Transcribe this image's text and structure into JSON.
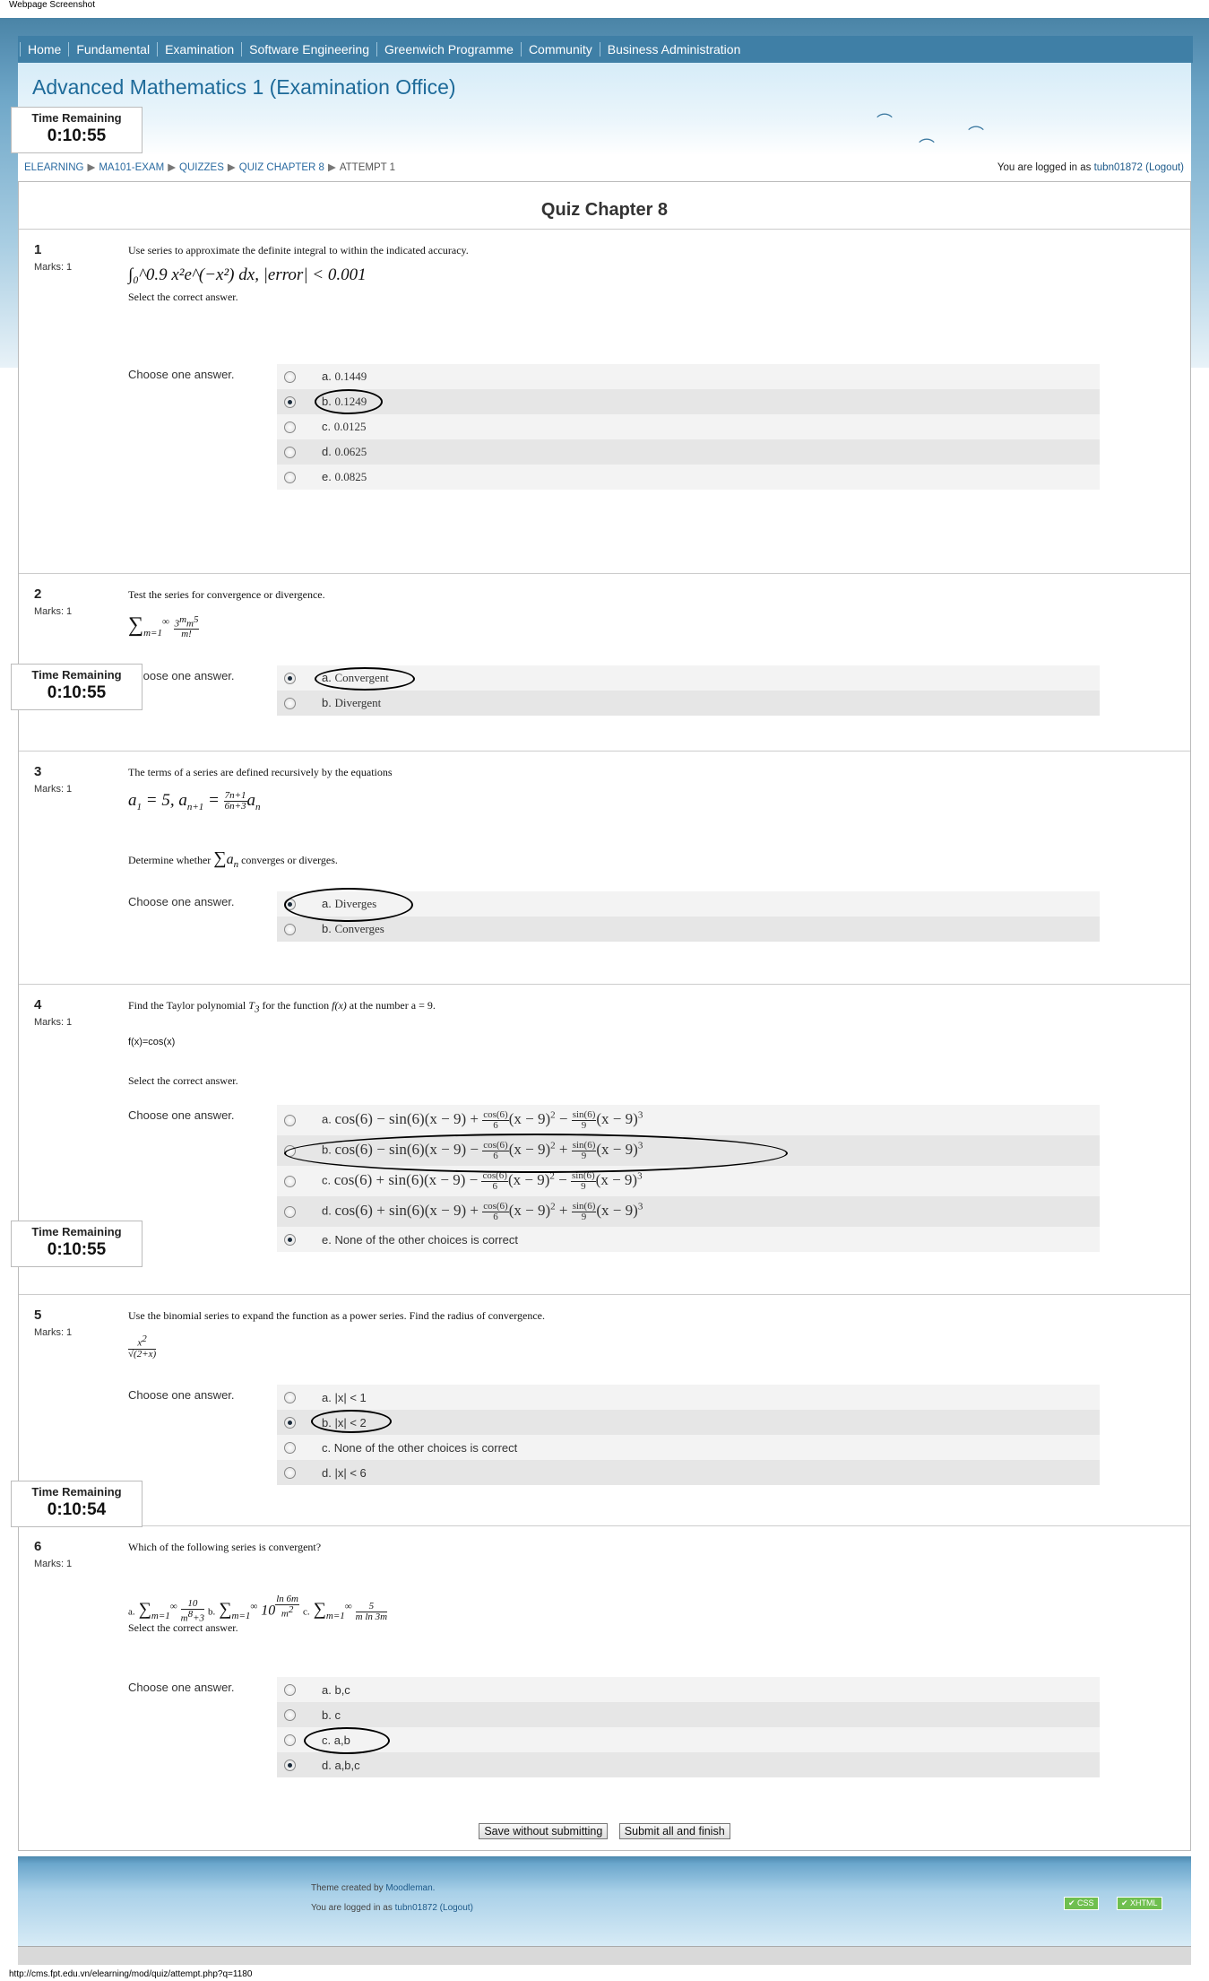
{
  "caption_top": "Webpage Screenshot",
  "caption_bottom": "http://cms.fpt.edu.vn/elearning/mod/quiz/attempt.php?q=1180",
  "nav": [
    "Home",
    "Fundamental",
    "Examination",
    "Software Engineering",
    "Greenwich Programme",
    "Community",
    "Business Administration"
  ],
  "banner_title": "Advanced Mathematics 1 (Examination Office)",
  "breadcrumb": [
    "ELEARNING",
    "MA101-EXAM",
    "QUIZZES",
    "QUIZ CHAPTER 8",
    "ATTEMPT 1"
  ],
  "login": {
    "prefix": "You are logged in as",
    "user": "tubn01872",
    "logout": "(Logout)"
  },
  "quiz_title": "Quiz Chapter 8",
  "timer": {
    "label": "Time Remaining",
    "values": [
      "0:10:55",
      "0:10:55",
      "0:10:55",
      "0:10:54"
    ]
  },
  "marks_label": "Marks: 1",
  "choose_label": "Choose one answer.",
  "questions": [
    {
      "number": "1",
      "text": "Use series to approximate the definite integral to within the indicated accuracy.",
      "math": "∫₀^0.9 x²e^(−x²) dx, |error| < 0.001",
      "after": "Select the correct answer.",
      "answers": [
        {
          "letter": "a.",
          "value": "0.1449"
        },
        {
          "letter": "b.",
          "value": "0.1249"
        },
        {
          "letter": "c.",
          "value": "0.0125"
        },
        {
          "letter": "d.",
          "value": "0.0625"
        },
        {
          "letter": "e.",
          "value": "0.0825"
        }
      ],
      "selected": 1
    },
    {
      "number": "2",
      "text": "Test the series for convergence or divergence.",
      "answers": [
        {
          "letter": "a.",
          "value": "Convergent"
        },
        {
          "letter": "b.",
          "value": "Divergent"
        }
      ],
      "selected": 0
    },
    {
      "number": "3",
      "text": "The terms of a series are defined recursively by the equations",
      "after": "converges or diverges.",
      "before": "Determine whether",
      "answers": [
        {
          "letter": "a.",
          "value": "Diverges"
        },
        {
          "letter": "b.",
          "value": "Converges"
        }
      ],
      "selected": 0
    },
    {
      "number": "4",
      "text_parts": [
        "Find the Taylor polynomial",
        "for the function",
        "at the number",
        "a = 9."
      ],
      "fx": "f(x)=cos(x)",
      "after": "Select the correct answer.",
      "answers": [
        {
          "letter": "a.",
          "value": ""
        },
        {
          "letter": "b.",
          "value": ""
        },
        {
          "letter": "c.",
          "value": ""
        },
        {
          "letter": "d.",
          "value": ""
        },
        {
          "letter": "e.",
          "value": "None of the other choices is correct"
        }
      ],
      "selected": 4
    },
    {
      "number": "5",
      "text": "Use the binomial series to expand the function as a power series. Find the radius of convergence.",
      "answers": [
        {
          "letter": "a.",
          "value": "|x| < 1"
        },
        {
          "letter": "b.",
          "value": "|x| < 2"
        },
        {
          "letter": "c.",
          "value": "None of the other choices is correct"
        },
        {
          "letter": "d.",
          "value": "|x| < 6"
        }
      ],
      "selected": 1
    },
    {
      "number": "6",
      "text": "Which of the following series is convergent?",
      "after": "Select the correct answer.",
      "answers": [
        {
          "letter": "a.",
          "value": "b,c"
        },
        {
          "letter": "b.",
          "value": "c"
        },
        {
          "letter": "c.",
          "value": "a,b"
        },
        {
          "letter": "d.",
          "value": "a,b,c"
        }
      ],
      "selected": 3
    }
  ],
  "buttons": {
    "save": "Save without submitting",
    "submit": "Submit all and finish"
  },
  "footer": {
    "theme_prefix": "Theme created by",
    "theme_author": "Moodleman.",
    "login_prefix": "You are logged in as",
    "user": "tubn01872",
    "logout": "(Logout)",
    "badge_css": "CSS",
    "badge_xhtml": "XHTML"
  }
}
